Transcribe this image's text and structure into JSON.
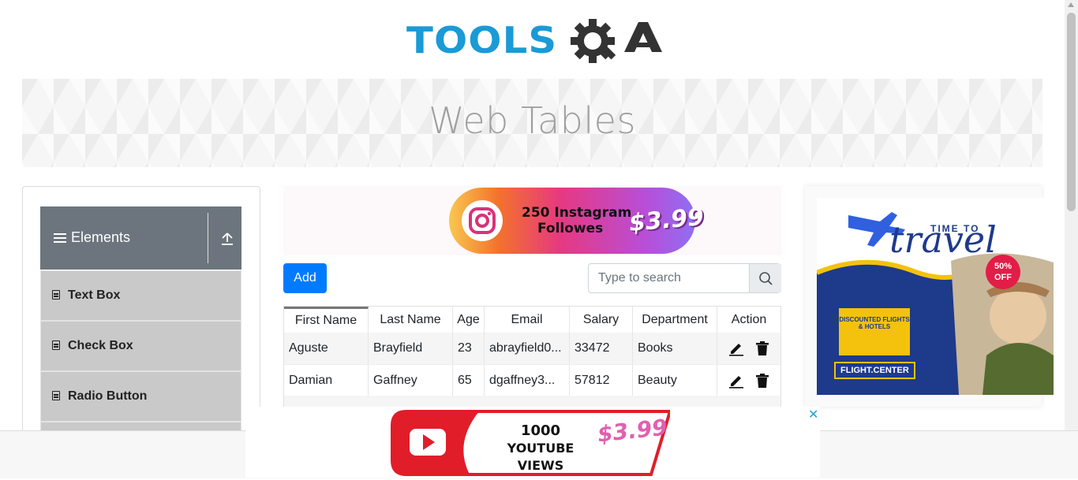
{
  "brand": {
    "logo_text_left": "TOOLS",
    "logo_text_right": "QA"
  },
  "banner": {
    "title": "Web Tables"
  },
  "sidebar": {
    "group": {
      "label": "Elements"
    },
    "items": [
      {
        "label": "Text Box"
      },
      {
        "label": "Check Box"
      },
      {
        "label": "Radio Button"
      }
    ]
  },
  "ads": {
    "instagram": {
      "line1": "250 Instagram",
      "line2": "Followes",
      "price": "$3.99"
    },
    "travel": {
      "time_to": "TIME TO",
      "travel": "travel",
      "discount": "50% OFF",
      "badge": "DISCOUNTED FLIGHTS & HOTELS",
      "brand": "FLIGHT.CENTER"
    },
    "youtube": {
      "line1": "1000",
      "line2": "YOUTUBE VIEWS",
      "price": "$3.99"
    },
    "close_glyph": "✕"
  },
  "toolbar": {
    "add_label": "Add",
    "search_placeholder": "Type to search"
  },
  "table": {
    "headers": [
      "First Name",
      "Last Name",
      "Age",
      "Email",
      "Salary",
      "Department",
      "Action"
    ],
    "rows": [
      {
        "first": "Aguste",
        "last": "Brayfield",
        "age": "23",
        "email": "abrayfield0...",
        "salary": "33472",
        "dept": "Books"
      },
      {
        "first": "Damian",
        "last": "Gaffney",
        "age": "65",
        "email": "dgaffney3...",
        "salary": "57812",
        "dept": "Beauty"
      }
    ]
  },
  "colors": {
    "primary": "#007bff",
    "logo_blue": "#1a9ad6",
    "header_gray": "#6c757d",
    "menu_gray": "#c9c9c9"
  }
}
